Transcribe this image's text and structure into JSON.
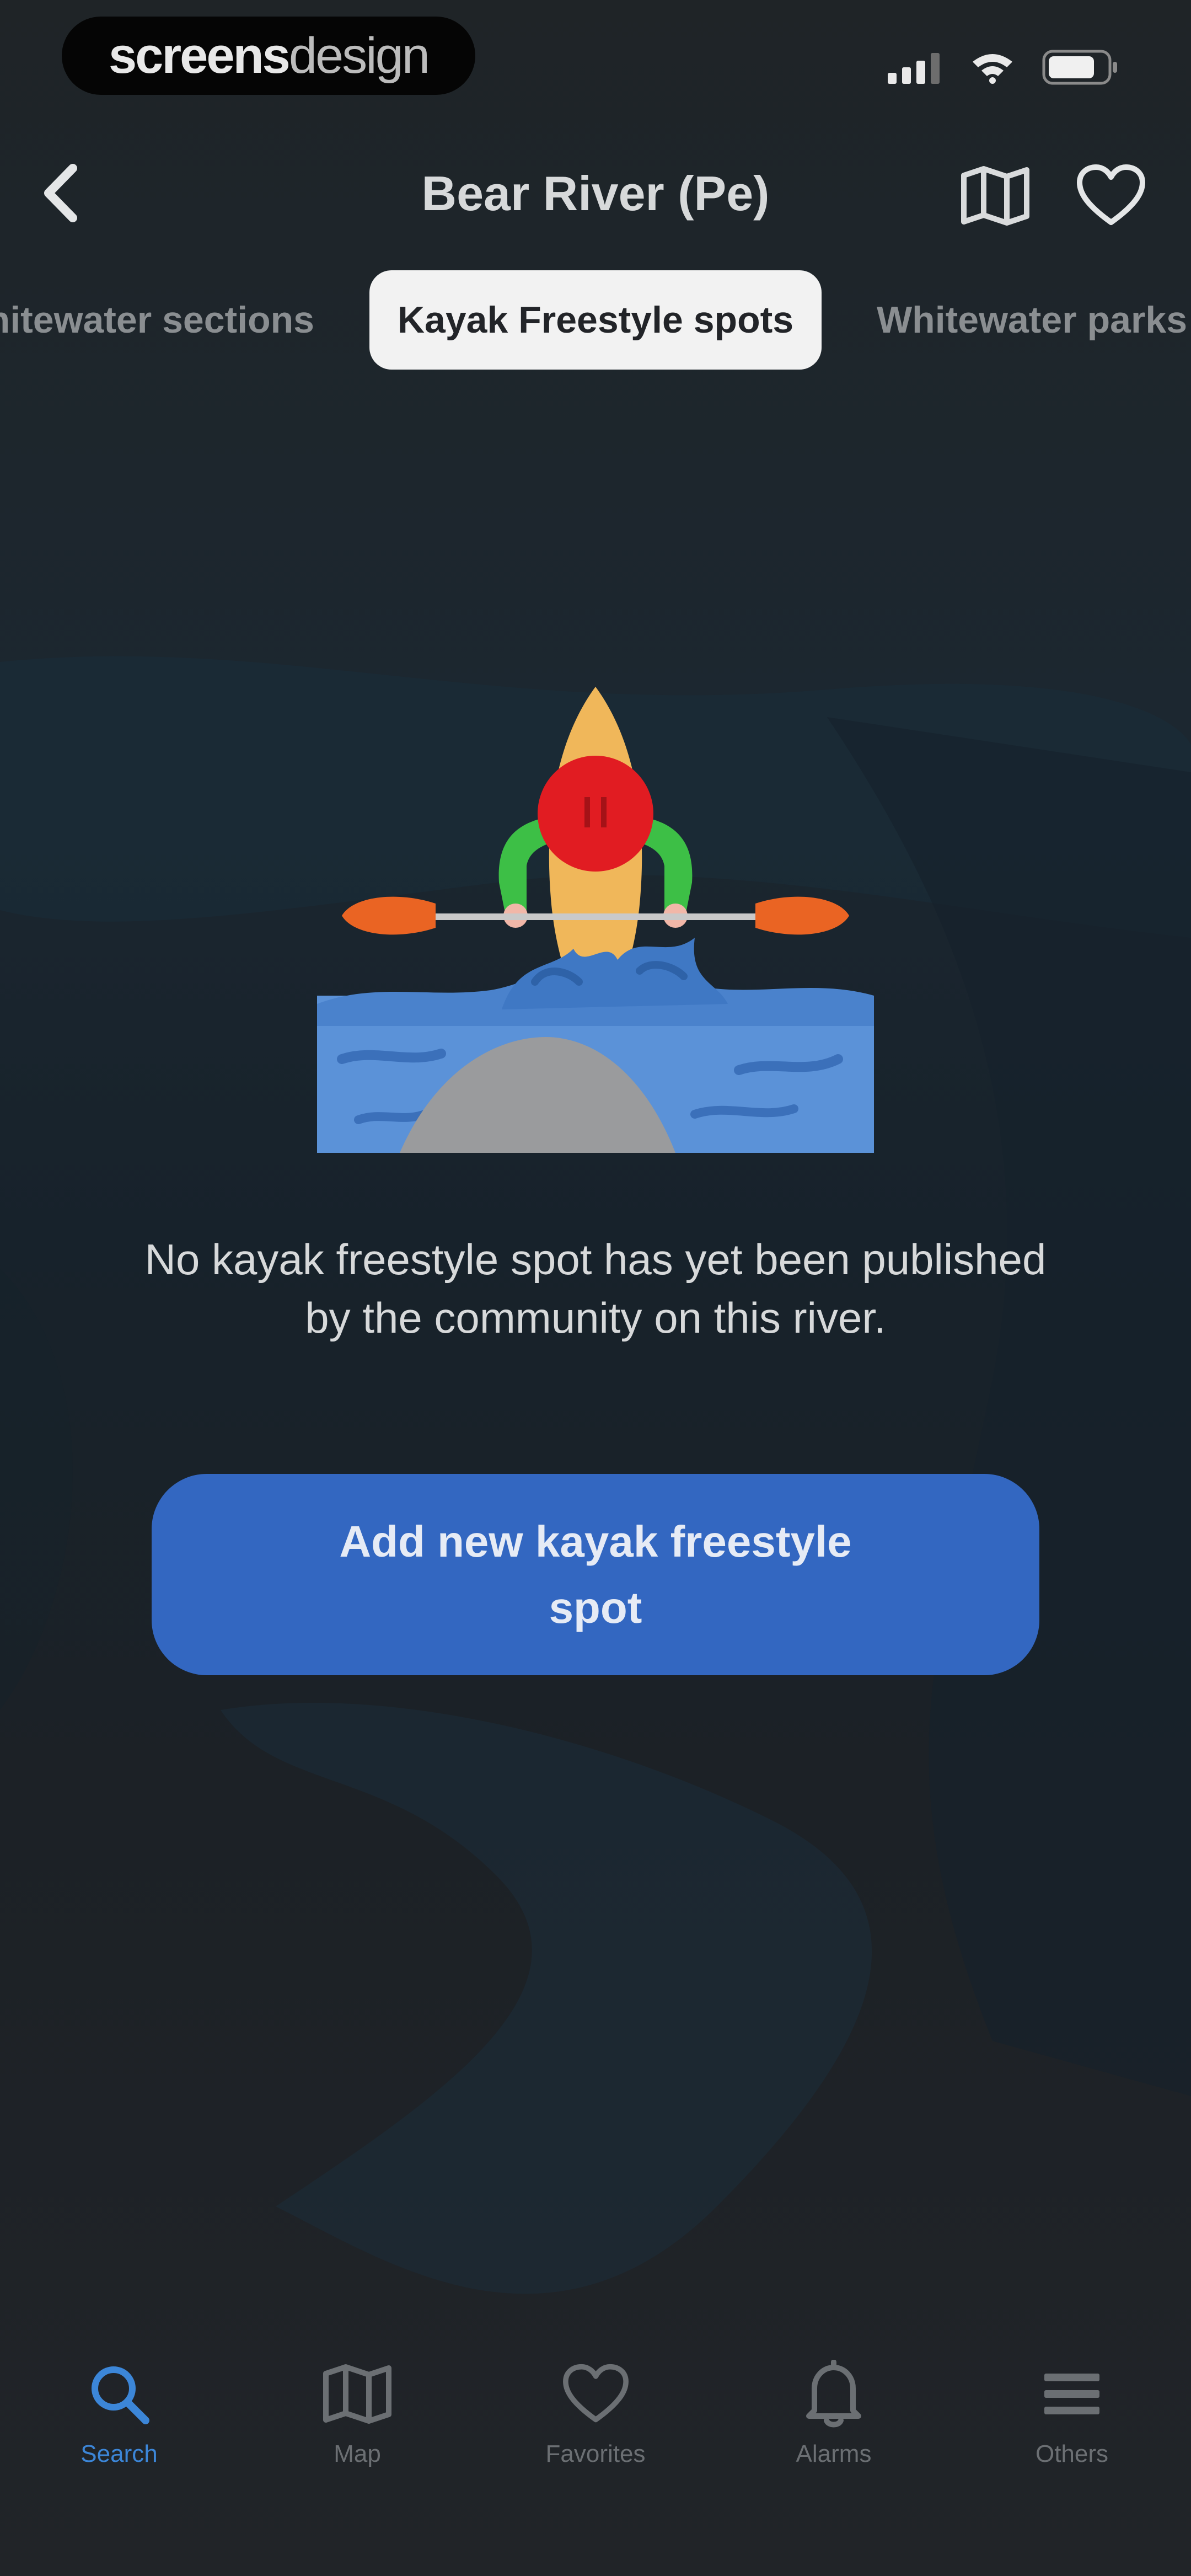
{
  "watermark": {
    "bold": "screens",
    "light": "design"
  },
  "header": {
    "title": "Bear River (Pe)"
  },
  "segments": [
    {
      "label": "Whitewater sections",
      "active": false
    },
    {
      "label": "Kayak Freestyle spots",
      "active": true
    },
    {
      "label": "Whitewater parks",
      "active": false
    }
  ],
  "empty_state": {
    "message": "No kayak freestyle spot has yet been published by the community on this river.",
    "button_label": "Add new kayak freestyle spot"
  },
  "tabbar": [
    {
      "label": "Search",
      "icon": "search-icon",
      "active": true
    },
    {
      "label": "Map",
      "icon": "map-icon",
      "active": false
    },
    {
      "label": "Favorites",
      "icon": "heart-icon",
      "active": false
    },
    {
      "label": "Alarms",
      "icon": "bell-icon",
      "active": false
    },
    {
      "label": "Others",
      "icon": "menu-icon",
      "active": false
    }
  ],
  "colors": {
    "accent": "#3367c1",
    "active_tab": "#3c86d8",
    "background": "#1e2225"
  }
}
